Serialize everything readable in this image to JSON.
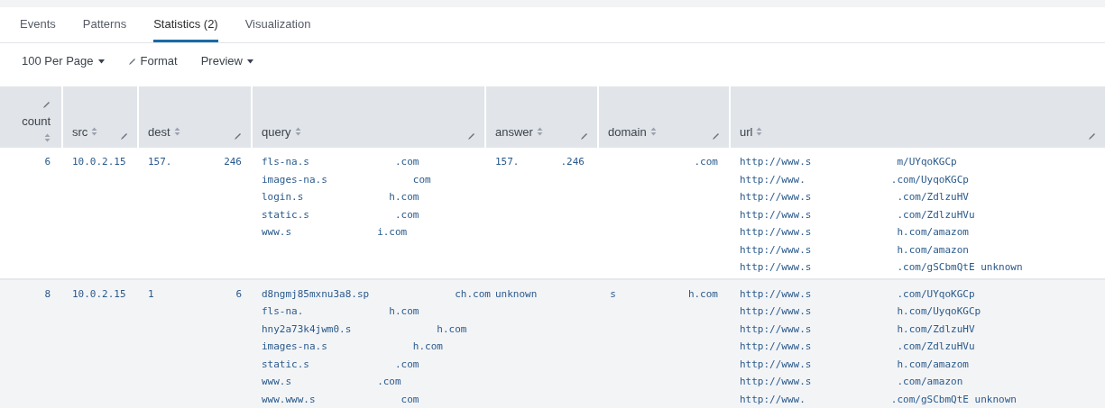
{
  "tabs": [
    {
      "label": "Events",
      "selected": false
    },
    {
      "label": "Patterns",
      "selected": false
    },
    {
      "label": "Statistics (2)",
      "selected": true
    },
    {
      "label": "Visualization",
      "selected": false
    }
  ],
  "toolbar": [
    {
      "kind": "dropdown",
      "label": "100 Per Page"
    },
    {
      "kind": "edit",
      "label": "Format"
    },
    {
      "kind": "dropdown",
      "label": "Preview"
    }
  ],
  "table": {
    "columns": [
      {
        "label": "count"
      },
      {
        "label": "src"
      },
      {
        "label": "dest"
      },
      {
        "label": "query"
      },
      {
        "label": "answer"
      },
      {
        "label": "domain"
      },
      {
        "label": "url"
      }
    ],
    "rows": [
      {
        "cells": [
          [
            [
              "6"
            ]
          ],
          [
            [
              "10.0.2.15"
            ]
          ],
          [
            [
              "157.",
              "246"
            ]
          ],
          [
            [
              "fls-na.s",
              ".com"
            ],
            [
              "images-na.s",
              "com"
            ],
            [
              "login.s",
              "h.com"
            ],
            [
              "static.s",
              ".com"
            ],
            [
              "www.s",
              "i.com"
            ]
          ],
          [
            [
              "157.",
              ".246"
            ]
          ],
          [
            [
              "",
              ".com"
            ]
          ],
          [
            [
              "http://www.s",
              "m/UYqoKGCp"
            ],
            [
              "http://www.",
              ".com/UyqoKGCp"
            ],
            [
              "http://www.s",
              ".com/ZdlzuHV"
            ],
            [
              "http://www.s",
              ".com/ZdlzuHVu"
            ],
            [
              "http://www.s",
              "h.com/amazom"
            ],
            [
              "http://www.s",
              "h.com/amazon"
            ],
            [
              "http://www.s",
              ".com/gSCbmQtE unknown"
            ]
          ]
        ]
      },
      {
        "cells": [
          [
            [
              "8"
            ]
          ],
          [
            [
              "10.0.2.15"
            ]
          ],
          [
            [
              "1",
              "6"
            ]
          ],
          [
            [
              "d8ngmj85mxnu3a8.sp",
              "ch.com"
            ],
            [
              "fls-na.",
              "h.com"
            ],
            [
              "hny2a73k4jwm0.s",
              "h.com"
            ],
            [
              "images-na.s",
              "h.com"
            ],
            [
              "static.s",
              ".com"
            ],
            [
              "www.s",
              ".com"
            ],
            [
              "www.www.s",
              "com"
            ]
          ],
          [
            [
              "unknown"
            ]
          ],
          [
            [
              "s",
              "h.com"
            ]
          ],
          [
            [
              "http://www.s",
              ".com/UYqoKGCp"
            ],
            [
              "http://www.s",
              "h.com/UyqoKGCp"
            ],
            [
              "http://www.s",
              "h.com/ZdlzuHV"
            ],
            [
              "http://www.s",
              ".com/ZdlzuHVu"
            ],
            [
              "http://www.s",
              "h.com/amazom"
            ],
            [
              "http://www.s",
              ".com/amazon"
            ],
            [
              "http://www.",
              ".com/gSCbmQtE unknown"
            ]
          ]
        ]
      }
    ]
  }
}
